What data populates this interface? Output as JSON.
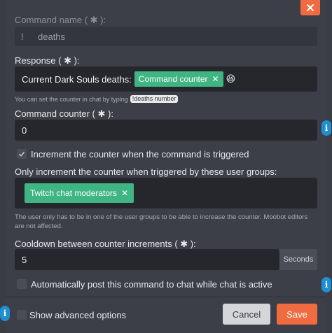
{
  "dialog": {
    "close_label": "×",
    "command_name": {
      "label": "Command name ( ✱ ):",
      "value": "deaths",
      "prefix": "!"
    },
    "response": {
      "label": "Response ( ✱ ):",
      "text": "Current Dark Souls deaths:",
      "tag": "Command counter",
      "tag_remove": "✕",
      "emoji": "😆",
      "hint": "You can set the counter in chat by typing",
      "hint_code": "!deaths number"
    },
    "counter": {
      "label": "Command counter ( ✱ ):",
      "value": "0"
    },
    "increment_checkbox": {
      "label": "Increment the counter when the command is triggered",
      "checked": true
    },
    "groups": {
      "label": "Only increment the counter when triggered by these user groups:",
      "tag": "Twitch chat moderators",
      "tag_remove": "✕",
      "hint": "The user only has to be in one of the user groups to be able to increase the counter. Moobot editors are not affected."
    },
    "cooldown": {
      "label": "Cooldown between counter increments ( ✱ ):",
      "value": "5",
      "unit": "Seconds"
    },
    "autopost_checkbox": {
      "label": "Automatically post this command to chat while chat is active",
      "checked": false
    },
    "advanced_checkbox": {
      "label": "Show advanced options",
      "checked": false
    },
    "buttons": {
      "cancel": "Cancel",
      "save": "Save"
    },
    "info_glyph": "i",
    "colors": {
      "accent": "#f06b3f",
      "tag_green": "#3fb584",
      "info_blue": "#1e8fd0"
    }
  }
}
